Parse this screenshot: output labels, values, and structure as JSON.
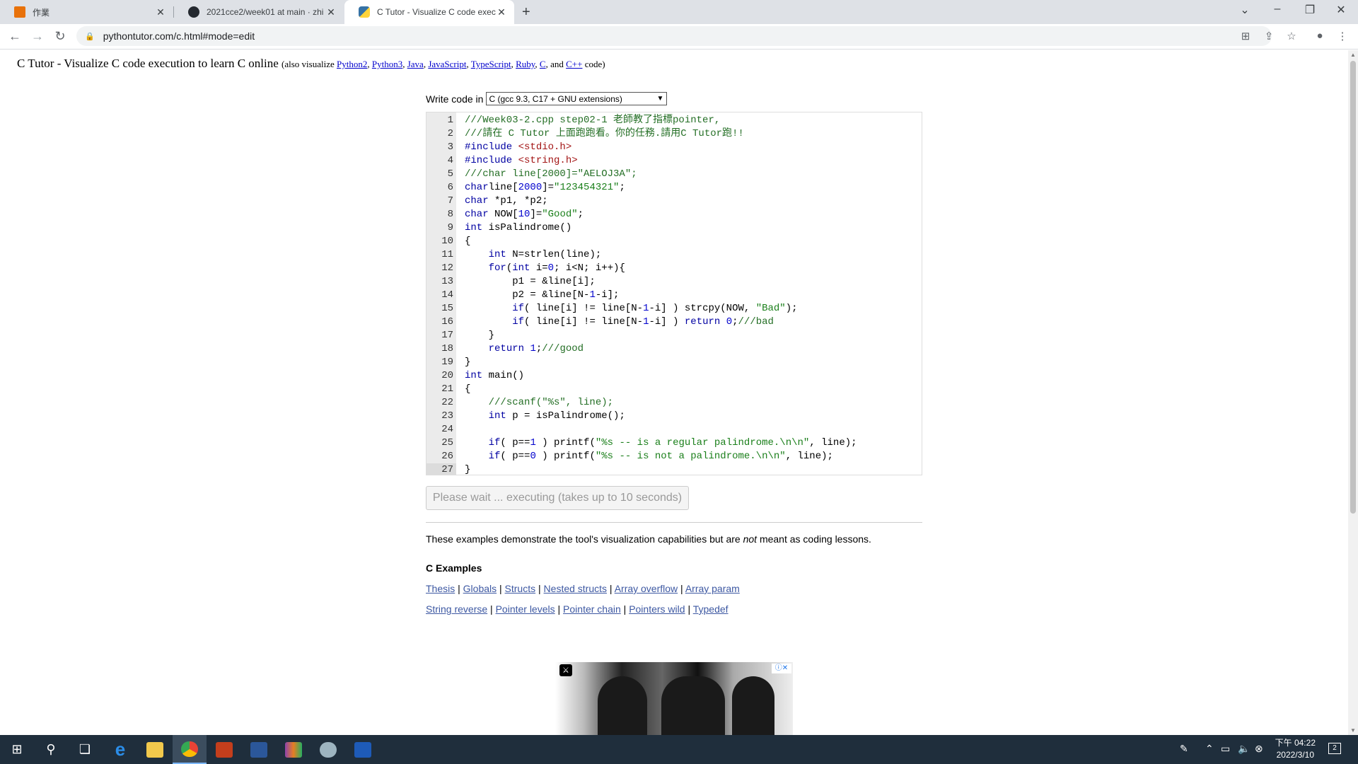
{
  "browser": {
    "tabs": [
      {
        "title": "作業",
        "active": false
      },
      {
        "title": "2021cce2/week01 at main · zhi",
        "active": false
      },
      {
        "title": "C Tutor - Visualize C code exec",
        "active": true
      }
    ],
    "new_tab_icon": "+",
    "url": "pythontutor.com/c.html#mode=edit"
  },
  "page": {
    "title_main": "C Tutor - Visualize C code execution to learn C online",
    "title_also": "(also visualize",
    "title_links": [
      "Python2",
      "Python3",
      "Java",
      "JavaScript",
      "TypeScript",
      "Ruby",
      "C"
    ],
    "title_and": "and",
    "title_last_link": "C++",
    "title_end": "code)",
    "write_code_label": "Write code in",
    "language_selected": "C (gcc 9.3, C17 + GNU extensions)",
    "run_button_label": "Please wait ... executing (takes up to 10 seconds)",
    "examples_note_a": "These examples demonstrate the tool's visualization capabilities but are ",
    "examples_note_em": "not",
    "examples_note_b": " meant as coding lessons.",
    "examples_title": "C Examples",
    "examples_row1": [
      "Thesis",
      "Globals",
      "Structs",
      "Nested structs",
      "Array overflow",
      "Array param"
    ],
    "examples_row2": [
      "String reverse",
      "Pointer levels",
      "Pointer chain",
      "Pointers wild",
      "Typedef"
    ]
  },
  "editor": {
    "current_line": 27,
    "lines": [
      {
        "n": "1",
        "segs": [
          [
            "cm",
            "///Week03-2.cpp step02-1 老師教了指標pointer,"
          ]
        ]
      },
      {
        "n": "2",
        "segs": [
          [
            "cm",
            "///請在 C Tutor 上面跑跑看。你的任務.請用C Tutor跑!!"
          ]
        ]
      },
      {
        "n": "3",
        "segs": [
          [
            "pp",
            "#include "
          ],
          [
            "inc",
            "<stdio.h>"
          ]
        ]
      },
      {
        "n": "4",
        "segs": [
          [
            "pp",
            "#include "
          ],
          [
            "inc",
            "<string.h>"
          ]
        ]
      },
      {
        "n": "5",
        "segs": [
          [
            "cm",
            "///char line[2000]=\"AELOJ3A\";"
          ]
        ]
      },
      {
        "n": "6",
        "segs": [
          [
            "kw",
            "char"
          ],
          [
            "",
            "line["
          ],
          [
            "num",
            "2000"
          ],
          [
            "",
            "]="
          ],
          [
            "str",
            "\"123454321\""
          ],
          [
            "",
            ";"
          ]
        ]
      },
      {
        "n": "7",
        "segs": [
          [
            "kw",
            "char"
          ],
          [
            "",
            " *p1, *p2;"
          ]
        ]
      },
      {
        "n": "8",
        "segs": [
          [
            "kw",
            "char"
          ],
          [
            "",
            " NOW["
          ],
          [
            "num",
            "10"
          ],
          [
            "",
            "]="
          ],
          [
            "str",
            "\"Good\""
          ],
          [
            "",
            ";"
          ]
        ]
      },
      {
        "n": "9",
        "segs": [
          [
            "kw",
            "int"
          ],
          [
            "",
            " isPalindrome()"
          ]
        ]
      },
      {
        "n": "10",
        "segs": [
          [
            "",
            "{"
          ]
        ]
      },
      {
        "n": "11",
        "segs": [
          [
            "",
            "    "
          ],
          [
            "kw",
            "int"
          ],
          [
            "",
            " N=strlen(line);"
          ]
        ]
      },
      {
        "n": "12",
        "segs": [
          [
            "",
            "    "
          ],
          [
            "kw",
            "for"
          ],
          [
            "",
            "("
          ],
          [
            "kw",
            "int"
          ],
          [
            "",
            " i="
          ],
          [
            "num",
            "0"
          ],
          [
            "",
            "; i<N; i++){"
          ]
        ]
      },
      {
        "n": "13",
        "segs": [
          [
            "",
            "        p1 = &line[i];"
          ]
        ]
      },
      {
        "n": "14",
        "segs": [
          [
            "",
            "        p2 = &line[N-"
          ],
          [
            "num",
            "1"
          ],
          [
            "",
            "-i];"
          ]
        ]
      },
      {
        "n": "15",
        "segs": [
          [
            "",
            "        "
          ],
          [
            "kw",
            "if"
          ],
          [
            "",
            "( line[i] != line[N-"
          ],
          [
            "num",
            "1"
          ],
          [
            "",
            "-i] ) strcpy(NOW, "
          ],
          [
            "str",
            "\"Bad\""
          ],
          [
            "",
            ");"
          ]
        ]
      },
      {
        "n": "16",
        "segs": [
          [
            "",
            "        "
          ],
          [
            "kw",
            "if"
          ],
          [
            "",
            "( line[i] != line[N-"
          ],
          [
            "num",
            "1"
          ],
          [
            "",
            "-i] ) "
          ],
          [
            "kw",
            "return"
          ],
          [
            "",
            " "
          ],
          [
            "num",
            "0"
          ],
          [
            "",
            ";"
          ],
          [
            "cm",
            "///bad"
          ]
        ]
      },
      {
        "n": "17",
        "segs": [
          [
            "",
            "    }"
          ]
        ]
      },
      {
        "n": "18",
        "segs": [
          [
            "",
            "    "
          ],
          [
            "kw",
            "return"
          ],
          [
            "",
            " "
          ],
          [
            "num",
            "1"
          ],
          [
            "",
            ";"
          ],
          [
            "cm",
            "///good"
          ]
        ]
      },
      {
        "n": "19",
        "segs": [
          [
            "",
            "}"
          ]
        ]
      },
      {
        "n": "20",
        "segs": [
          [
            "kw",
            "int"
          ],
          [
            "",
            " main()"
          ]
        ]
      },
      {
        "n": "21",
        "segs": [
          [
            "",
            "{"
          ]
        ]
      },
      {
        "n": "22",
        "segs": [
          [
            "",
            "    "
          ],
          [
            "cm",
            "///scanf(\"%s\", line);"
          ]
        ]
      },
      {
        "n": "23",
        "segs": [
          [
            "",
            "    "
          ],
          [
            "kw",
            "int"
          ],
          [
            "",
            " p = isPalindrome();"
          ]
        ]
      },
      {
        "n": "24",
        "segs": [
          [
            "",
            ""
          ]
        ]
      },
      {
        "n": "25",
        "segs": [
          [
            "",
            "    "
          ],
          [
            "kw",
            "if"
          ],
          [
            "",
            "( p=="
          ],
          [
            "num",
            "1"
          ],
          [
            "",
            " ) printf("
          ],
          [
            "str",
            "\"%s -- is a regular palindrome.\\n\\n\""
          ],
          [
            "",
            ", line);"
          ]
        ]
      },
      {
        "n": "26",
        "segs": [
          [
            "",
            "    "
          ],
          [
            "kw",
            "if"
          ],
          [
            "",
            "( p=="
          ],
          [
            "num",
            "0"
          ],
          [
            "",
            " ) printf("
          ],
          [
            "str",
            "\"%s -- is not a palindrome.\\n\\n\""
          ],
          [
            "",
            ", line);"
          ]
        ]
      },
      {
        "n": "27",
        "segs": [
          [
            "",
            "}"
          ]
        ]
      }
    ]
  },
  "taskbar": {
    "clock_time": "下午 04:22",
    "clock_date": "2022/3/10",
    "notification_count": "2",
    "apps": [
      "start-icon",
      "search-icon",
      "task-view-icon",
      "internet-explorer-icon",
      "file-explorer-icon",
      "chrome-icon",
      "powerpoint-icon",
      "word-icon",
      "winrar-icon",
      "app-icon",
      "devcpp-icon"
    ]
  },
  "colors": {
    "comment": "#236e24",
    "keyword": "#0000a2",
    "link": "#3d58a2",
    "taskbar": "#1f2e3c"
  }
}
